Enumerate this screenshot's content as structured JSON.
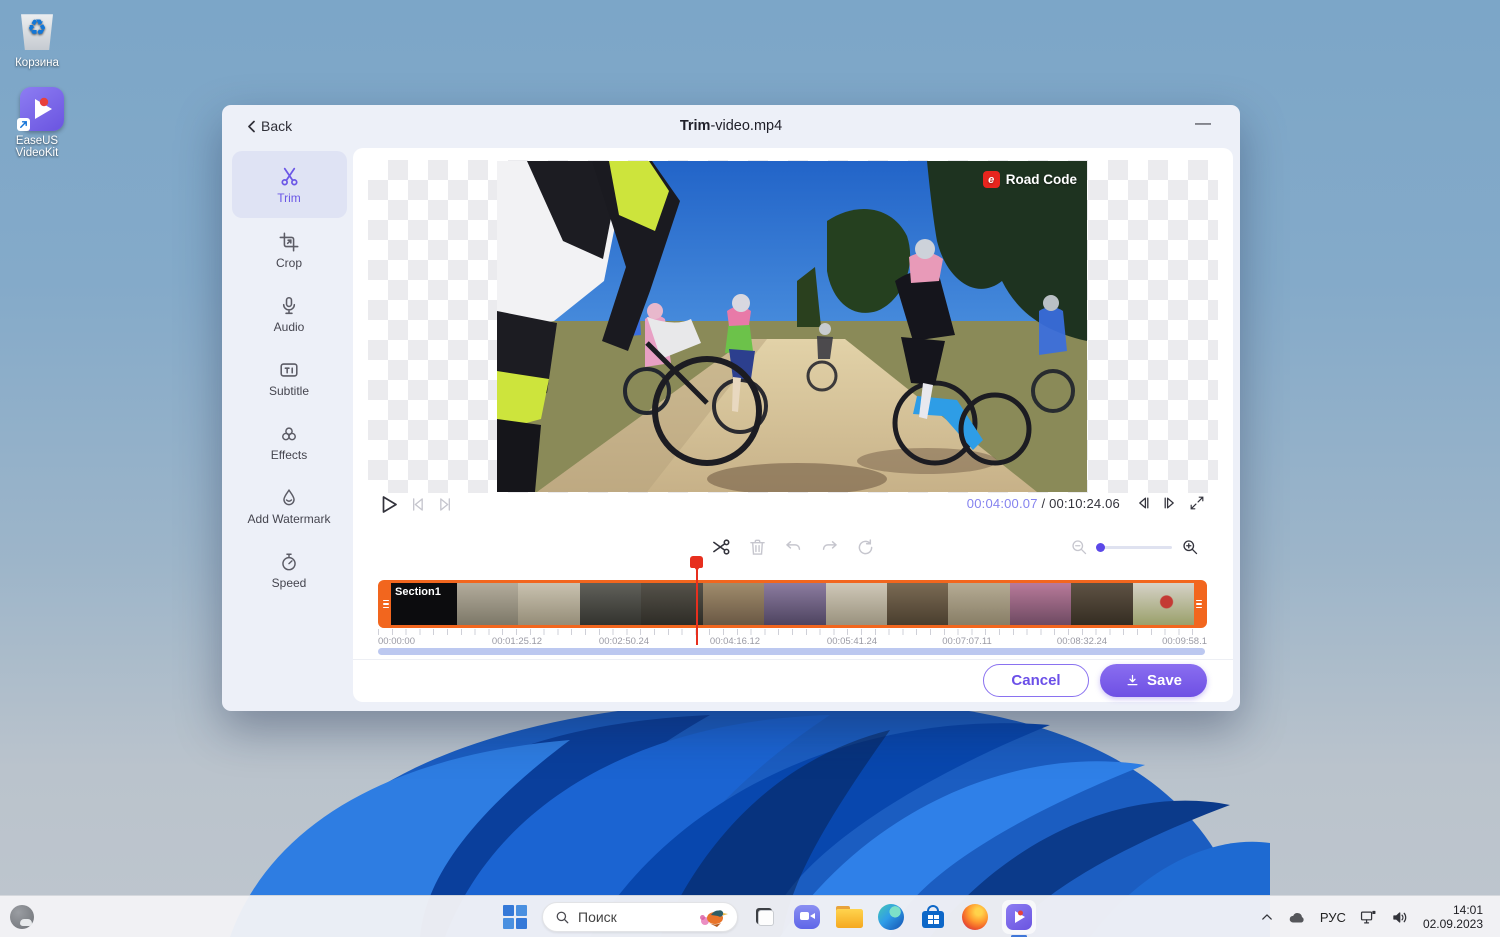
{
  "desktop": {
    "recycle_label": "Корзина",
    "easeus_label": "EaseUS VideoKit"
  },
  "window": {
    "back_label": "Back",
    "title_bold": "Trim",
    "title_rest": "-video.mp4",
    "minimize_glyph": "—"
  },
  "sidebar": {
    "items": [
      {
        "label": "Trim"
      },
      {
        "label": "Crop"
      },
      {
        "label": "Audio"
      },
      {
        "label": "Subtitle"
      },
      {
        "label": "Effects"
      },
      {
        "label": "Add Watermark"
      },
      {
        "label": "Speed"
      }
    ]
  },
  "player": {
    "current_time": "00:04:00.07",
    "separator": " / ",
    "total_time": "00:10:24.06",
    "watermark_label": "Road Code",
    "watermark_badge": "e"
  },
  "timeline": {
    "section_label": "Section1",
    "ruler": [
      "00:00:00",
      "00:01:25.12",
      "00:02:50.24",
      "00:04:16.12",
      "00:05:41.24",
      "00:07:07.11",
      "00:08:32.24",
      "00:09:58.1"
    ]
  },
  "footer": {
    "cancel_label": "Cancel",
    "save_label": "Save"
  },
  "taskbar": {
    "search_text": "Поиск",
    "language_label": "РУС",
    "clock_time": "14:01",
    "clock_date": "02.09.2023"
  },
  "colors": {
    "accent_purple": "#6b57e6",
    "timeline_orange": "#f2661e",
    "playhead_red": "#e72f1e",
    "time_current": "#8583ef"
  }
}
